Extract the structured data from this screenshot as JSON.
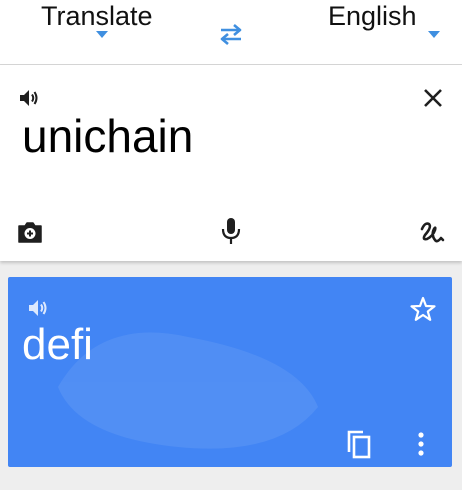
{
  "languages": {
    "source": "Translate",
    "target": "English"
  },
  "input": {
    "text": "unichain"
  },
  "result": {
    "text": "defi"
  },
  "colors": {
    "accent": "#3f8fe0",
    "result_card": "#4285f4",
    "icon_dark": "#1f1f1f"
  },
  "icons": [
    "chevron-down-icon",
    "swap-languages-icon",
    "speaker-icon",
    "close-icon",
    "camera-icon",
    "microphone-icon",
    "handwriting-icon",
    "star-icon",
    "copy-icon",
    "more-vert-icon"
  ]
}
